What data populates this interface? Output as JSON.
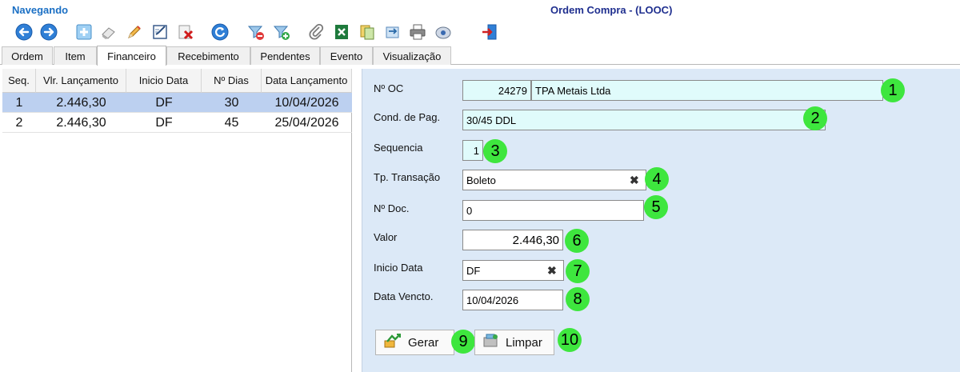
{
  "window": {
    "status": "Navegando",
    "title": "Ordem Compra - (LOOC)"
  },
  "toolbar": {
    "icons": [
      "back-icon",
      "forward-icon",
      "new-icon",
      "eraser-icon",
      "edit-icon",
      "checklist-icon",
      "delete-icon",
      "refresh-icon",
      "filter-remove-icon",
      "filter-add-icon",
      "attach-icon",
      "excel-icon",
      "copy-icon",
      "export-icon",
      "print-icon",
      "email-icon",
      "exit-icon"
    ]
  },
  "tabs": [
    "Ordem",
    "Item",
    "Financeiro",
    "Recebimento",
    "Pendentes",
    "Evento",
    "Visualização"
  ],
  "active_tab": "Financeiro",
  "grid": {
    "columns": [
      "Seq.",
      "Vlr. Lançamento",
      "Inicio Data",
      "Nº Dias",
      "Data Lançamento"
    ],
    "rows": [
      {
        "seq": "1",
        "valor": "2.446,30",
        "inicio": "DF",
        "dias": "30",
        "data": "10/04/2026"
      },
      {
        "seq": "2",
        "valor": "2.446,30",
        "inicio": "DF",
        "dias": "45",
        "data": "25/04/2026"
      }
    ]
  },
  "form": {
    "oc_label": "Nº OC",
    "oc_number": "24279",
    "oc_supplier": "TPA Metais Ltda",
    "cond_label": "Cond. de Pag.",
    "cond_value": "30/45 DDL",
    "seq_label": "Sequencia",
    "seq_value": "1",
    "transacao_label": "Tp. Transação",
    "transacao_value": "Boleto",
    "doc_label": "Nº Doc.",
    "doc_value": "0",
    "valor_label": "Valor",
    "valor_value": "2.446,30",
    "inicio_label": "Inicio Data",
    "inicio_value": "DF",
    "venc_label": "Data Vencto.",
    "venc_value": "10/04/2026",
    "gerar_label": "Gerar",
    "limpar_label": "Limpar",
    "clear_glyph": "✖"
  },
  "badges": [
    "1",
    "2",
    "3",
    "4",
    "5",
    "6",
    "7",
    "8",
    "9",
    "10"
  ],
  "colors": {
    "badge": "#3ee63e",
    "form_bg": "#dce9f7",
    "selected_row": "#bcd0f0",
    "title_blue": "#1a6fc4"
  }
}
